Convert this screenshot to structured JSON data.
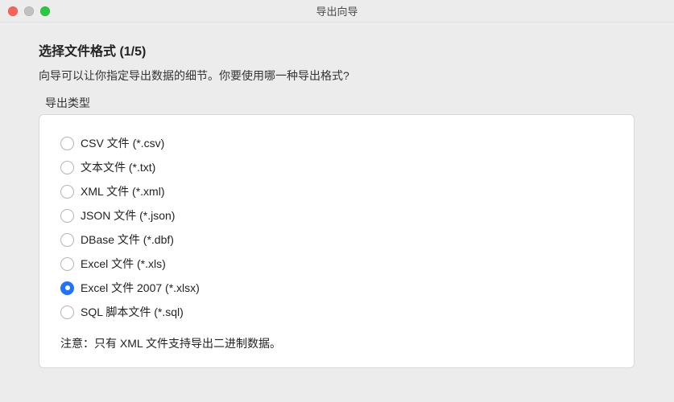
{
  "window": {
    "title": "导出向导"
  },
  "wizard": {
    "heading": "选择文件格式 (1/5)",
    "subheading": "向导可以让你指定导出数据的细节。你要使用哪一种导出格式?",
    "group_label": "导出类型",
    "options": [
      {
        "label": "CSV 文件 (*.csv)",
        "selected": false
      },
      {
        "label": "文本文件 (*.txt)",
        "selected": false
      },
      {
        "label": "XML 文件 (*.xml)",
        "selected": false
      },
      {
        "label": "JSON 文件 (*.json)",
        "selected": false
      },
      {
        "label": "DBase 文件 (*.dbf)",
        "selected": false
      },
      {
        "label": "Excel 文件 (*.xls)",
        "selected": false
      },
      {
        "label": "Excel 文件 2007 (*.xlsx)",
        "selected": true
      },
      {
        "label": "SQL 脚本文件 (*.sql)",
        "selected": false
      }
    ],
    "note": "注意：只有 XML 文件支持导出二进制数据。"
  }
}
